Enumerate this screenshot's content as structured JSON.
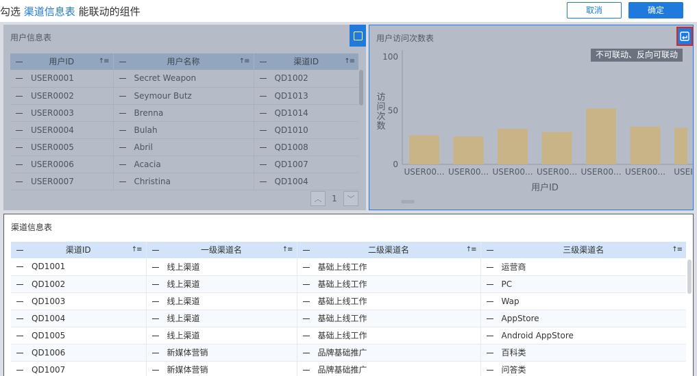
{
  "header": {
    "prefix": "勾选",
    "highlight": "渠道信息表",
    "suffix": "能联动的组件",
    "cancel_label": "取消",
    "ok_label": "确定"
  },
  "user_table": {
    "title": "用户信息表",
    "columns": [
      "用户ID",
      "用户名称",
      "渠道ID"
    ],
    "rows": [
      [
        "USER0001",
        "Secret Weapon",
        "QD1002"
      ],
      [
        "USER0002",
        "Seymour Butz",
        "QD1013"
      ],
      [
        "USER0003",
        "Brenna",
        "QD1014"
      ],
      [
        "USER0004",
        "Bulah",
        "QD1010"
      ],
      [
        "USER0005",
        "Abril",
        "QD1008"
      ],
      [
        "USER0006",
        "Acacia",
        "QD1007"
      ],
      [
        "USER0007",
        "Christina",
        "QD1004"
      ]
    ],
    "page": "1"
  },
  "chart_panel": {
    "title": "用户访问次数表",
    "tooltip": "不可联动、反向可联动"
  },
  "chart_data": {
    "type": "bar",
    "categories": [
      "USER00...",
      "USER00...",
      "USER00...",
      "USER00...",
      "USER00...",
      "USER00...",
      "USEI"
    ],
    "values": [
      27,
      26,
      33,
      30,
      52,
      35,
      34
    ],
    "xlabel": "用户ID",
    "ylabel": "访问次数",
    "ylim": [
      0,
      100
    ],
    "yticks": [
      "100",
      "50",
      "0"
    ],
    "bar_color": "#c8b486"
  },
  "channel_table": {
    "title": "渠道信息表",
    "columns": [
      "渠道ID",
      "一级渠道名",
      "二级渠道名",
      "三级渠道名"
    ],
    "rows": [
      [
        "QD1001",
        "线上渠道",
        "基础上线工作",
        "运营商"
      ],
      [
        "QD1002",
        "线上渠道",
        "基础上线工作",
        "PC"
      ],
      [
        "QD1003",
        "线上渠道",
        "基础上线工作",
        "Wap"
      ],
      [
        "QD1004",
        "线上渠道",
        "基础上线工作",
        "AppStore"
      ],
      [
        "QD1005",
        "线上渠道",
        "基础上线工作",
        "Android AppStore"
      ],
      [
        "QD1006",
        "新媒体营销",
        "品牌基础推广",
        "百科类"
      ],
      [
        "QD1007",
        "新媒体营销",
        "品牌基础推广",
        "问答类"
      ]
    ]
  },
  "icons": {
    "sort": "sort-icon",
    "select": "checkbox-icon",
    "linkage": "linkage-toggle-icon",
    "prev": "chevron-up-icon",
    "next": "chevron-down-icon"
  },
  "colors": {
    "accent": "#1f7adb",
    "highlight_border": "#e2231a",
    "dim_overlay": "#b5bcc7",
    "channel_header": "#d3e4fa"
  }
}
